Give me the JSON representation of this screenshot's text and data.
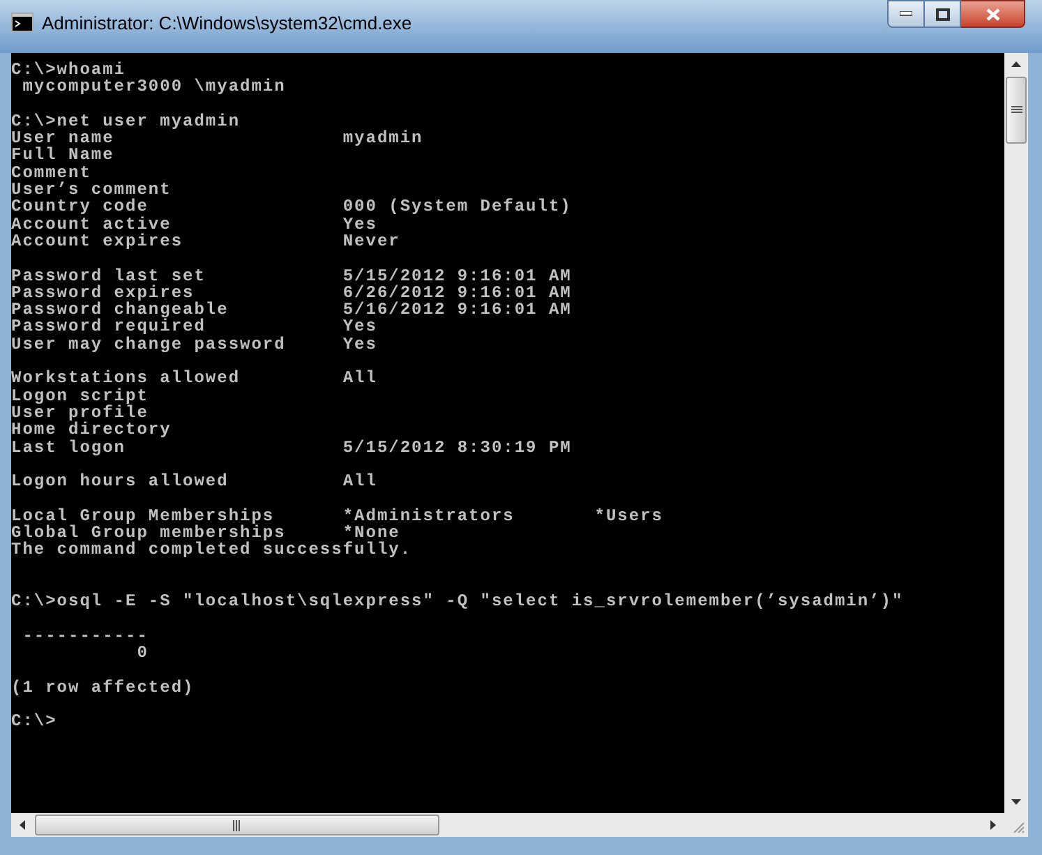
{
  "window": {
    "title": "Administrator: C:\\Windows\\system32\\cmd.exe"
  },
  "console_lines": [
    {
      "kind": "text",
      "text": "C:\\>whoami"
    },
    {
      "kind": "text",
      "text": " mycomputer3000 \\myadmin"
    },
    {
      "kind": "blank"
    },
    {
      "kind": "text",
      "text": "C:\\>net user myadmin"
    },
    {
      "kind": "text",
      "text": "User name                    myadmin"
    },
    {
      "kind": "text",
      "text": "Full Name"
    },
    {
      "kind": "text",
      "text": "Comment"
    },
    {
      "kind": "text",
      "text": "User’s comment"
    },
    {
      "kind": "text",
      "text": "Country code                 000 (System Default)"
    },
    {
      "kind": "text",
      "text": "Account active               Yes"
    },
    {
      "kind": "text",
      "text": "Account expires              Never"
    },
    {
      "kind": "blank"
    },
    {
      "kind": "text",
      "text": "Password last set            5/15/2012 9:16:01 AM"
    },
    {
      "kind": "text",
      "text": "Password expires             6/26/2012 9:16:01 AM"
    },
    {
      "kind": "text",
      "text": "Password changeable          5/16/2012 9:16:01 AM"
    },
    {
      "kind": "text",
      "text": "Password required            Yes"
    },
    {
      "kind": "text",
      "text": "User may change password     Yes"
    },
    {
      "kind": "blank"
    },
    {
      "kind": "text",
      "text": "Workstations allowed         All"
    },
    {
      "kind": "text",
      "text": "Logon script"
    },
    {
      "kind": "text",
      "text": "User profile"
    },
    {
      "kind": "text",
      "text": "Home directory"
    },
    {
      "kind": "text",
      "text": "Last logon                   5/15/2012 8:30:19 PM"
    },
    {
      "kind": "blank"
    },
    {
      "kind": "text",
      "text": "Logon hours allowed          All"
    },
    {
      "kind": "blank"
    },
    {
      "kind": "text",
      "text": "Local Group Memberships      *Administrators       *Users"
    },
    {
      "kind": "text",
      "text": "Global Group memberships     *None"
    },
    {
      "kind": "text",
      "text": "The command completed successfully."
    },
    {
      "kind": "blank"
    },
    {
      "kind": "blank"
    },
    {
      "kind": "text",
      "text": "C:\\>osql -E -S \"localhost\\sqlexpress\" -Q \"select is_srvrolemember(’sysadmin’)\""
    },
    {
      "kind": "blank"
    },
    {
      "kind": "text",
      "text": " -----------"
    },
    {
      "kind": "text",
      "text": "           0"
    },
    {
      "kind": "blank"
    },
    {
      "kind": "text",
      "text": "(1 row affected)"
    },
    {
      "kind": "blank"
    },
    {
      "kind": "text",
      "text": "C:\\>"
    }
  ]
}
